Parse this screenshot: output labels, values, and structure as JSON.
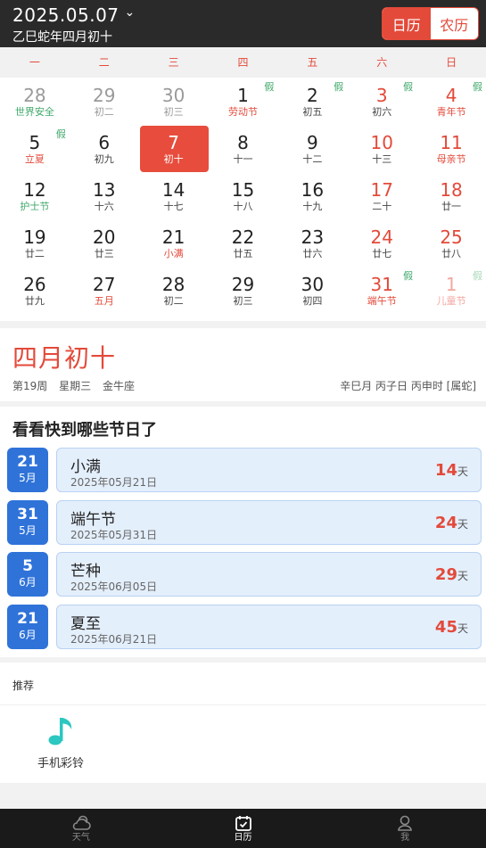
{
  "header": {
    "date": "2025.05.07",
    "lunar": "乙巳蛇年四月初十",
    "segments": {
      "solar": "日历",
      "lunar": "农历"
    }
  },
  "weekdays": [
    "一",
    "二",
    "三",
    "四",
    "五",
    "六",
    "日"
  ],
  "calendar": {
    "rows": [
      [
        {
          "num": "28",
          "sub": "世界安全",
          "kind": "other",
          "sub_style": "green"
        },
        {
          "num": "29",
          "sub": "初二",
          "kind": "other"
        },
        {
          "num": "30",
          "sub": "初三",
          "kind": "other"
        },
        {
          "num": "1",
          "sub": "劳动节",
          "tag": "假",
          "sub_style": "red"
        },
        {
          "num": "2",
          "sub": "初五",
          "tag": "假"
        },
        {
          "num": "3",
          "sub": "初六",
          "tag": "假",
          "kind": "red"
        },
        {
          "num": "4",
          "sub": "青年节",
          "tag": "假",
          "kind": "red",
          "sub_style": "red"
        }
      ],
      [
        {
          "num": "5",
          "sub": "立夏",
          "tag": "假",
          "sub_style": "red"
        },
        {
          "num": "6",
          "sub": "初九"
        },
        {
          "num": "7",
          "sub": "初十",
          "kind": "sel"
        },
        {
          "num": "8",
          "sub": "十一"
        },
        {
          "num": "9",
          "sub": "十二"
        },
        {
          "num": "10",
          "sub": "十三",
          "kind": "red"
        },
        {
          "num": "11",
          "sub": "母亲节",
          "kind": "red",
          "sub_style": "red"
        }
      ],
      [
        {
          "num": "12",
          "sub": "护士节",
          "sub_style": "green"
        },
        {
          "num": "13",
          "sub": "十六"
        },
        {
          "num": "14",
          "sub": "十七"
        },
        {
          "num": "15",
          "sub": "十八"
        },
        {
          "num": "16",
          "sub": "十九"
        },
        {
          "num": "17",
          "sub": "二十",
          "kind": "red"
        },
        {
          "num": "18",
          "sub": "廿一",
          "kind": "red"
        }
      ],
      [
        {
          "num": "19",
          "sub": "廿二"
        },
        {
          "num": "20",
          "sub": "廿三"
        },
        {
          "num": "21",
          "sub": "小满",
          "sub_style": "red"
        },
        {
          "num": "22",
          "sub": "廿五"
        },
        {
          "num": "23",
          "sub": "廿六"
        },
        {
          "num": "24",
          "sub": "廿七",
          "kind": "red"
        },
        {
          "num": "25",
          "sub": "廿八",
          "kind": "red"
        }
      ],
      [
        {
          "num": "26",
          "sub": "廿九"
        },
        {
          "num": "27",
          "sub": "五月",
          "sub_style": "red"
        },
        {
          "num": "28",
          "sub": "初二"
        },
        {
          "num": "29",
          "sub": "初三"
        },
        {
          "num": "30",
          "sub": "初四"
        },
        {
          "num": "31",
          "sub": "端午节",
          "tag": "假",
          "kind": "red",
          "sub_style": "red"
        },
        {
          "num": "1",
          "sub": "儿童节",
          "tag": "假",
          "kind": "faded"
        }
      ]
    ]
  },
  "detail": {
    "lunar_big": "四月初十",
    "week": "第19周",
    "weekday": "星期三",
    "zodiac_sign": "金牛座",
    "ganzhi": "辛巳月 丙子日 丙申时 [属蛇]"
  },
  "holidays": {
    "title": "看看快到哪些节日了",
    "unit": "天",
    "items": [
      {
        "day": "21",
        "month": "5月",
        "name": "小满",
        "date": "2025年05月21日",
        "days": "14"
      },
      {
        "day": "31",
        "month": "5月",
        "name": "端午节",
        "date": "2025年05月31日",
        "days": "24"
      },
      {
        "day": "5",
        "month": "6月",
        "name": "芒种",
        "date": "2025年06月05日",
        "days": "29"
      },
      {
        "day": "21",
        "month": "6月",
        "name": "夏至",
        "date": "2025年06月21日",
        "days": "45"
      }
    ]
  },
  "recommend": {
    "label": "推荐",
    "items": [
      {
        "label": "手机彩铃",
        "icon": "music-note-icon",
        "color": "#2bc7c0"
      }
    ]
  },
  "nav": {
    "tabs": [
      {
        "label": "天气",
        "icon": "weather-icon"
      },
      {
        "label": "日历",
        "icon": "calendar-icon",
        "active": true
      },
      {
        "label": "我",
        "icon": "profile-icon"
      }
    ]
  },
  "colors": {
    "accent": "#e34a3a",
    "header_bg": "#2a2a2a",
    "badge_blue": "#2f73d9",
    "card_bg": "#e4effc",
    "holiday_green": "#3fa86a"
  }
}
